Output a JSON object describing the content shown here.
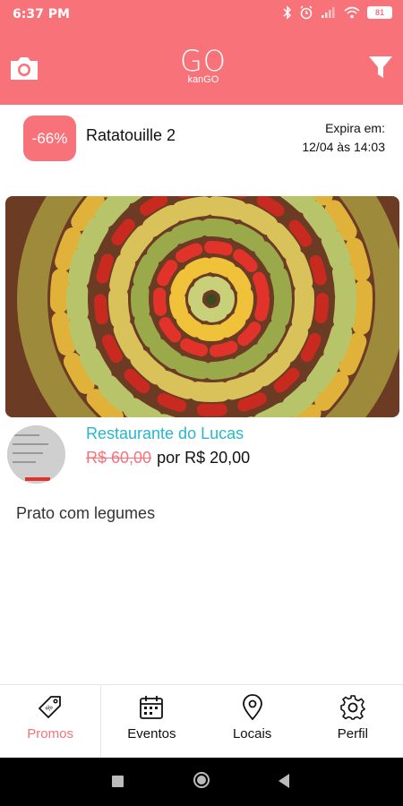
{
  "status_bar": {
    "time": "6:37 PM",
    "battery": "81"
  },
  "app_bar": {
    "logo_text": "GO",
    "logo_subtitle": "kanGO"
  },
  "promo": {
    "discount": "-66%",
    "title": "Ratatouille 2",
    "expires_label": "Expira em:",
    "expires_value": "12/04 às 14:03",
    "restaurant": "Restaurante do Lucas",
    "old_price": "R$ 60,00",
    "price_text": "por R$ 20,00",
    "description": "Prato com legumes"
  },
  "tabs": [
    {
      "label": "Promos",
      "icon": "tag-icon",
      "active": true
    },
    {
      "label": "Eventos",
      "icon": "calendar-icon",
      "active": false
    },
    {
      "label": "Locais",
      "icon": "map-pin-icon",
      "active": false
    },
    {
      "label": "Perfil",
      "icon": "gear-icon",
      "active": false
    }
  ],
  "colors": {
    "accent": "#f8727a",
    "link": "#27b7c9"
  }
}
